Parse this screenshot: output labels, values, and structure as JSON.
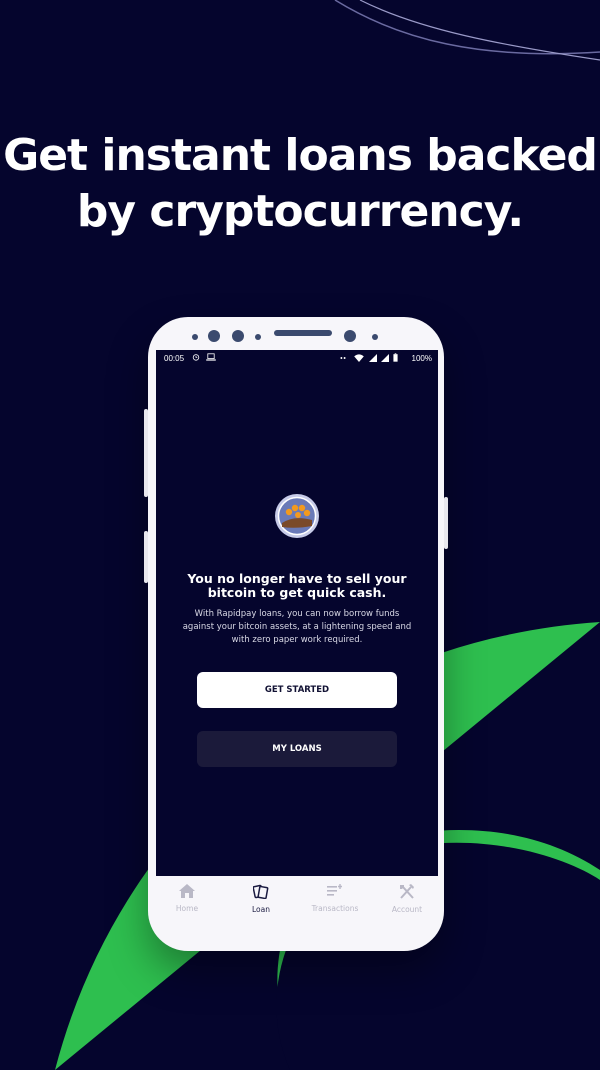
{
  "headline": {
    "line1": "Get instant loans backed",
    "line2": "by cryptocurrency."
  },
  "colors": {
    "background": "#05052d",
    "accent_green": "#2ebf4f",
    "button_primary": "#ffffff",
    "button_secondary": "#1b1a3a"
  },
  "statusbar": {
    "time": "00:05",
    "battery": "100%",
    "left_icons": [
      "alarm-icon",
      "laptop-icon"
    ],
    "right_icons": [
      "dots-icon",
      "wifi-icon",
      "signal-icon",
      "battery-icon"
    ]
  },
  "screen": {
    "logo_icon": "bitcoin-hand-logo",
    "title": "You no longer have to sell your bitcoin to get quick cash.",
    "description": "With Rapidpay loans, you can now borrow funds against your bitcoin assets, at a lightening speed and with zero paper work required.",
    "primary_button": "GET STARTED",
    "secondary_button": "MY LOANS"
  },
  "tabs": [
    {
      "label": "Home",
      "icon": "home-icon",
      "active": false
    },
    {
      "label": "Loan",
      "icon": "loan-cards-icon",
      "active": true
    },
    {
      "label": "Transactions",
      "icon": "transactions-list-icon",
      "active": false
    },
    {
      "label": "Account",
      "icon": "tools-icon",
      "active": false
    }
  ]
}
